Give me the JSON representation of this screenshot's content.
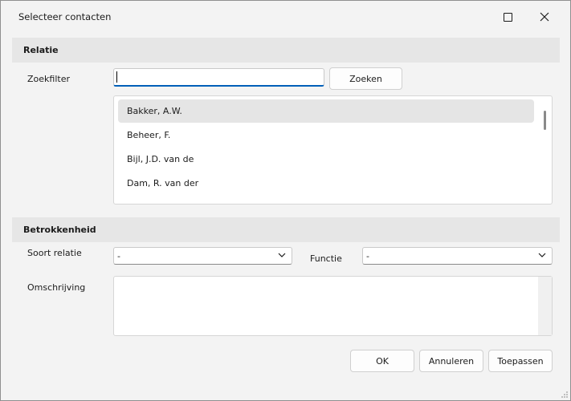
{
  "window": {
    "title": "Selecteer contacten"
  },
  "relatie": {
    "section_label": "Relatie",
    "zoekfilter_label": "Zoekfilter",
    "search_value": "",
    "search_button": "Zoeken",
    "contacts": [
      "Bakker, A.W.",
      "Beheer, F.",
      "Bijl, J.D. van de",
      "Dam, R. van der"
    ],
    "selected_index": 0
  },
  "betrokkenheid": {
    "section_label": "Betrokkenheid",
    "soort_relatie_label": "Soort relatie",
    "soort_relatie_value": "-",
    "functie_label": "Functie",
    "functie_value": "-",
    "omschrijving_label": "Omschrijving",
    "omschrijving_value": ""
  },
  "buttons": {
    "ok": "OK",
    "cancel": "Annuleren",
    "apply": "Toepassen"
  },
  "icons": {
    "maximize": "maximize-icon",
    "close": "close-icon",
    "dropdown": "chevron-down-icon",
    "resize": "resize-grip-icon"
  },
  "colors": {
    "focus_accent": "#005fb8",
    "selection": "#e5e5e5"
  }
}
